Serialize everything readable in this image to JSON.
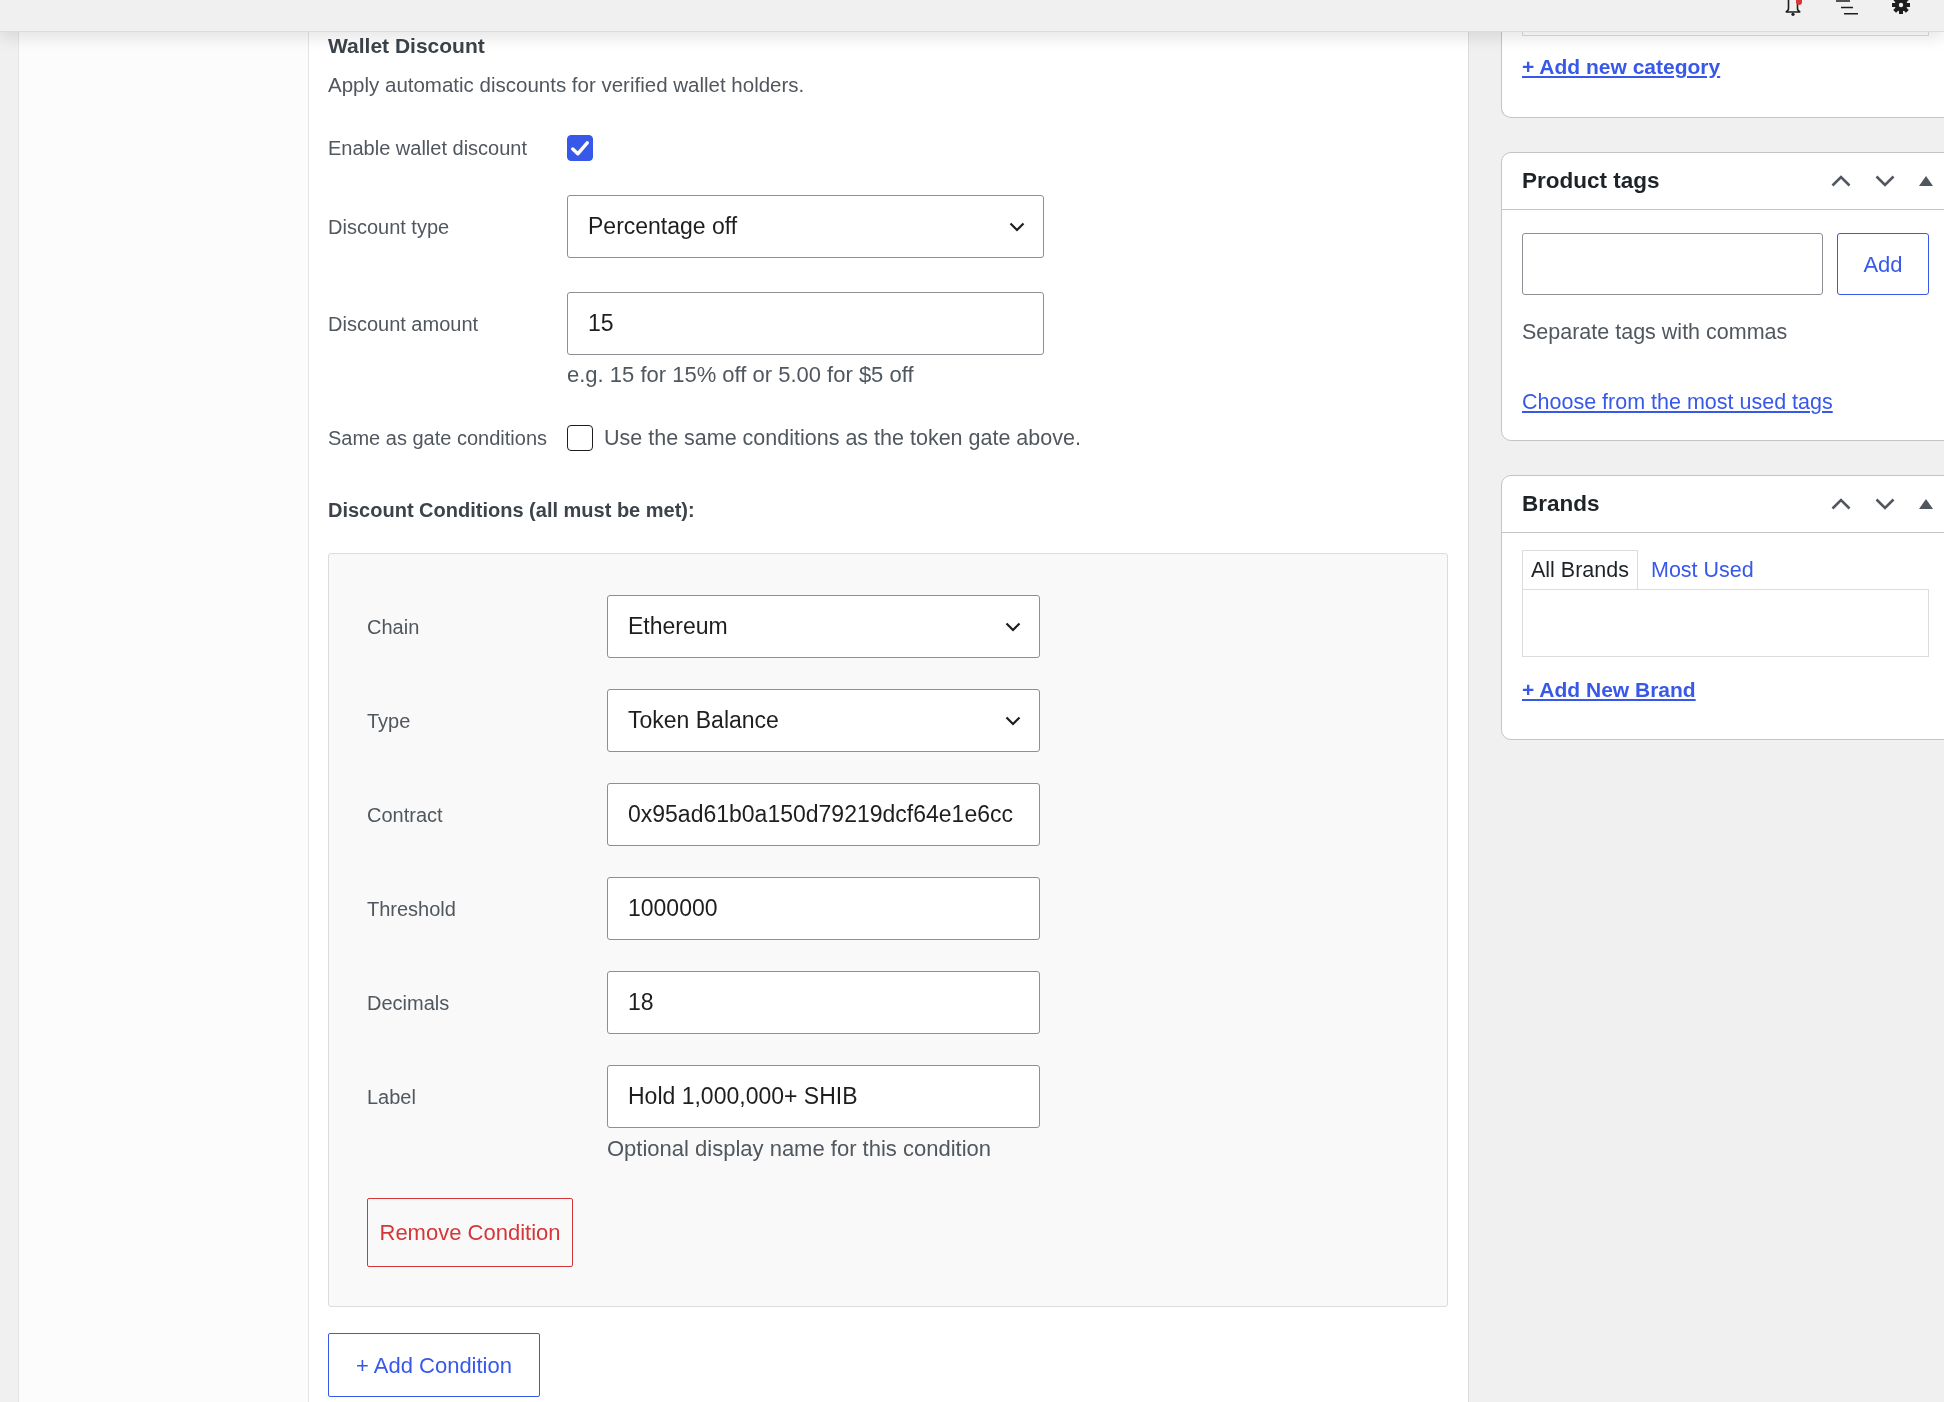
{
  "wallet_discount": {
    "title": "Wallet Discount",
    "description": "Apply automatic discounts for verified wallet holders.",
    "fields": [
      {
        "kind": "checkbox",
        "label": "Enable wallet discount",
        "checked": true
      },
      {
        "kind": "select",
        "label": "Discount type",
        "value": "Percentage off"
      },
      {
        "kind": "text",
        "label": "Discount amount",
        "value": "15",
        "hint": "e.g. 15 for 15% off or 5.00 for $5 off"
      },
      {
        "kind": "checkbox",
        "label": "Same as gate conditions",
        "checked": false,
        "text": "Use the same conditions as the token gate above."
      }
    ],
    "conditions_heading": "Discount Conditions (all must be met):",
    "conditions": [
      {
        "fields": [
          {
            "kind": "select",
            "label": "Chain",
            "value": "Ethereum"
          },
          {
            "kind": "select",
            "label": "Type",
            "value": "Token Balance"
          },
          {
            "kind": "text",
            "label": "Contract",
            "value": "0x95ad61b0a150d79219dcf64e1e6cc"
          },
          {
            "kind": "text",
            "label": "Threshold",
            "value": "1000000"
          },
          {
            "kind": "text",
            "label": "Decimals",
            "value": "18"
          },
          {
            "kind": "text",
            "label": "Label",
            "value": "Hold 1,000,000+ SHIB",
            "hint": "Optional display name for this condition"
          }
        ],
        "remove_button": "Remove Condition"
      }
    ],
    "add_condition_button": "+ Add Condition"
  },
  "sidebar": {
    "categories_box": {
      "add_link": "+ Add new category"
    },
    "tags_box": {
      "title": "Product tags",
      "add_button": "Add",
      "help": "Separate tags with commas",
      "most_used_link": "Choose from the most used tags"
    },
    "brands_box": {
      "title": "Brands",
      "tabs": [
        {
          "label": "All Brands",
          "selected": true
        },
        {
          "label": "Most Used",
          "selected": false
        }
      ],
      "add_link": "+ Add New Brand"
    }
  }
}
